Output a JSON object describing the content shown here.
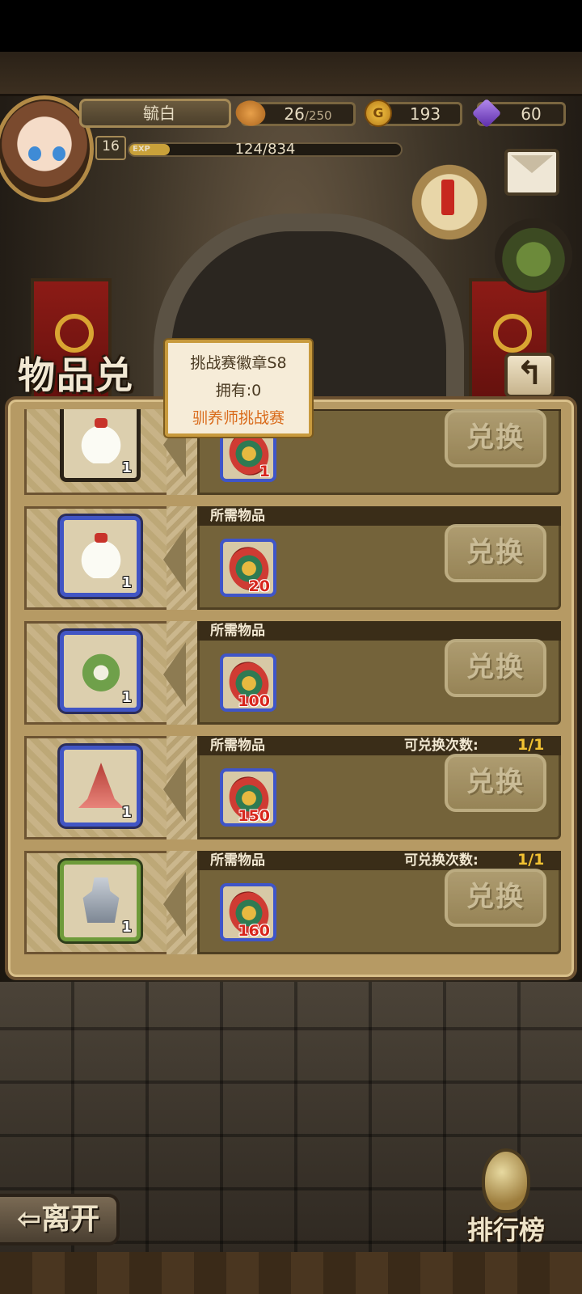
{
  "player": {
    "name": "毓白",
    "level": "16",
    "exp_tag": "EXP",
    "exp_text": "124/834",
    "exp_progress": 0.1487
  },
  "resources": {
    "stamina": {
      "value": "26",
      "max": "/250"
    },
    "gold": {
      "icon_letter": "G",
      "value": "193"
    },
    "gems": {
      "value": "60"
    }
  },
  "page": {
    "title": "物品兑换",
    "title_visible": "物品兑"
  },
  "tooltip": {
    "name": "挑战赛徽章S8",
    "owned": "拥有:0",
    "source": "驯养师挑战赛"
  },
  "rows": [
    {
      "item_qty": "1",
      "required_label": "",
      "cost": "1",
      "limit_label": "",
      "limit_value": "",
      "button": "兑换"
    },
    {
      "item_qty": "1",
      "required_label": "所需物品",
      "cost": "20",
      "limit_label": "",
      "limit_value": "",
      "button": "兑换"
    },
    {
      "item_qty": "1",
      "required_label": "所需物品",
      "cost": "100",
      "limit_label": "",
      "limit_value": "",
      "button": "兑换"
    },
    {
      "item_qty": "1",
      "required_label": "所需物品",
      "cost": "150",
      "limit_label": "可兑换次数:",
      "limit_value": "1/1",
      "button": "兑换"
    },
    {
      "item_qty": "1",
      "required_label": "所需物品",
      "cost": "160",
      "limit_label": "可兑换次数:",
      "limit_value": "1/1",
      "button": "兑换"
    }
  ],
  "bottom": {
    "leave": "⇦离开",
    "ranking": "排行榜"
  },
  "icons": {
    "stamina": "bread-icon",
    "gold": "gold-coin-icon",
    "gems": "gem-icon",
    "quest": "quest-scroll-icon",
    "mail": "mail-icon",
    "bag": "backpack-icon",
    "back": "back-arrow-icon",
    "cost": "challenge-badge-icon"
  },
  "colors": {
    "accent": "#f2c232",
    "cost_text": "#d8261c",
    "tooltip_source": "#d96a1a",
    "rare_border": "#4155c4"
  }
}
